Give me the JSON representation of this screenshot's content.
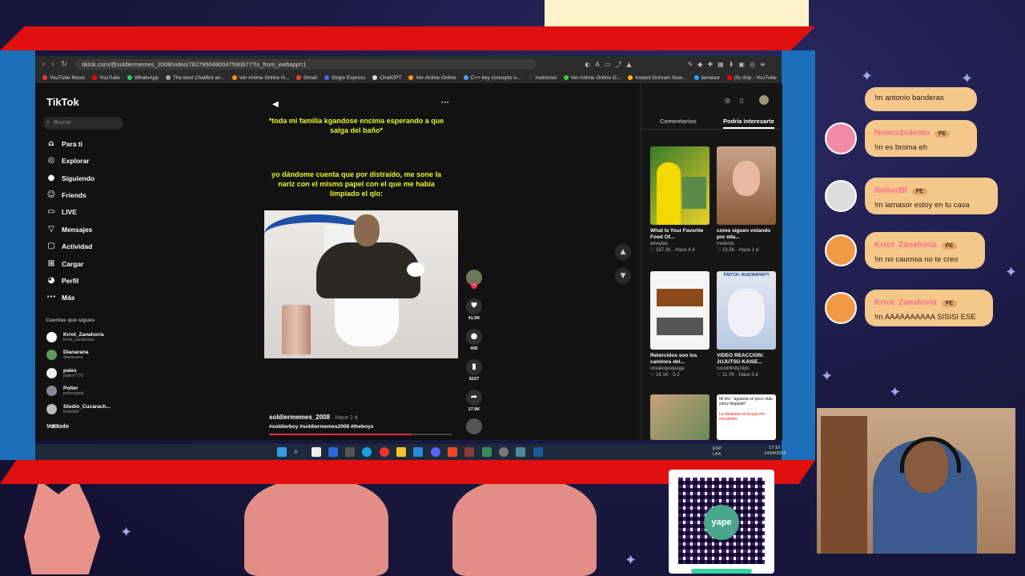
{
  "browser": {
    "url": "tiktok.com/@soldiermemes_2008/video/7627950480047590677?is_from_webapp=1",
    "bookmarks": [
      "YouTube Music",
      "YouTube",
      "WhatsApp",
      "The best ChatBot an...",
      "Ver Anime Online H...",
      "Gmail",
      "Stripe Express",
      "ChatGPT",
      "Ver Anime Online",
      "C++ key concepts o...",
      "metricool",
      "Ver Anime Online G...",
      "Instant Domain Sear...",
      "lamasor",
      "(9) chip - YouTube"
    ]
  },
  "tiktok": {
    "logo": "TikTok",
    "search_placeholder": "Buscar",
    "nav": [
      "Para ti",
      "Explorar",
      "Siguiendo",
      "Friends",
      "LIVE",
      "Mensajes",
      "Actividad",
      "Cargar",
      "Perfil",
      "Más"
    ],
    "following_title": "Cuentas que sigues",
    "following": [
      {
        "name": "Krrot_Zanahoria",
        "handle": "krrot_zanahoria"
      },
      {
        "name": "Dianarana",
        "handle": "dianarana"
      },
      {
        "name": "palex",
        "handle": "palex7770"
      },
      {
        "name": "Polter",
        "handle": "poltergeist"
      },
      {
        "name": "Studio_Cucarach...",
        "handle": "lmlnddd"
      }
    ],
    "see_all": "Ver todo",
    "video": {
      "text1": "*toda mi familia kgandose encima esperando a que salga del baño*",
      "text2": "yo dándome cuenta que por distraído, me sone la nariz con el mismo papel con el que me había limpiado el qlo:",
      "author": "soldiermemes_2008",
      "time": "· Hace 2 d",
      "tags": "#soldierboy #soldiermemes2008 #theboys",
      "progress": 0.78
    },
    "actions": {
      "likes": "41.5K",
      "comments": "405",
      "saves": "5227",
      "shares": "17.9K"
    },
    "tabs": {
      "comments": "Comentarios",
      "interest": "Podría interesarte"
    },
    "cards": [
      {
        "title": "What Is Your Favorite Food Of...",
        "user": "wheylee",
        "meta": "♡ 187.1K · Hace 4 d"
      },
      {
        "title": "como siguen votando por ella...",
        "user": "molestic",
        "meta": "♡ 23.5K · Hace 1 d"
      },
      {
        "title": "Retorcidos son los caminos del...",
        "user": "unvaloquejuega",
        "meta": "♡ 24.1K · 2-2"
      },
      {
        "title": "VIDEO REACCIÓN: JUJUTSU KAISE...",
        "user": "rusoinfinityclips",
        "meta": "♡ 11.7K · Hace 3 d"
      }
    ],
    "card_overlay": "Mi bro: \"aguanta un poco más, estoy llegando\"",
    "card_overlay2": "La situación en la que me encuentro:",
    "card_thumb_text": "TWITCH: RUSOINFINITY"
  },
  "taskbar": {
    "lang": "ESP LAA",
    "time": "17:10",
    "date": "14/04/2026"
  },
  "chat": [
    {
      "name": "",
      "msg": "!m antonio banderas"
    },
    {
      "name": "Nowcubulento",
      "badge": "PE",
      "msg": "!m es broma eh"
    },
    {
      "name": "ReikerBl",
      "badge": "PE",
      "msg": "!m lamasor estoy en tu casa"
    },
    {
      "name": "Krrot_Zanahoria",
      "badge": "PE",
      "msg": "!m no caumsa no te creo"
    },
    {
      "name": "Krrot_Zanahoria",
      "badge": "PE",
      "msg": "!m AAAAAAAAAA SISISI ESE"
    }
  ],
  "qr": {
    "brand": "yape"
  },
  "colors": {
    "red": "#e01010",
    "tiktok_pink": "#fe2c55",
    "caption_yellow": "#e8f531",
    "bubble": "#f4c78b"
  }
}
